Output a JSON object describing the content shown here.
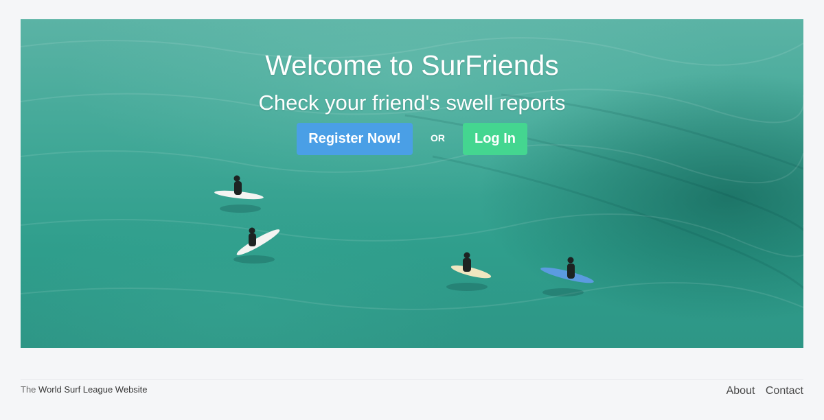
{
  "hero": {
    "title": "Welcome to SurFriends",
    "subtitle": "Check your friend's swell reports",
    "register_label": "Register Now!",
    "or_label": "OR",
    "login_label": "Log In"
  },
  "footer": {
    "prefix": "The",
    "link_text": "World Surf League Website",
    "links": [
      "About",
      "Contact"
    ]
  },
  "colors": {
    "register_button": "#4a9fe6",
    "login_button": "#44d690",
    "page_background": "#f5f6f8",
    "water": "#3fa796"
  },
  "icons": {
    "hero_image": "surfers-on-turquoise-water-image"
  }
}
